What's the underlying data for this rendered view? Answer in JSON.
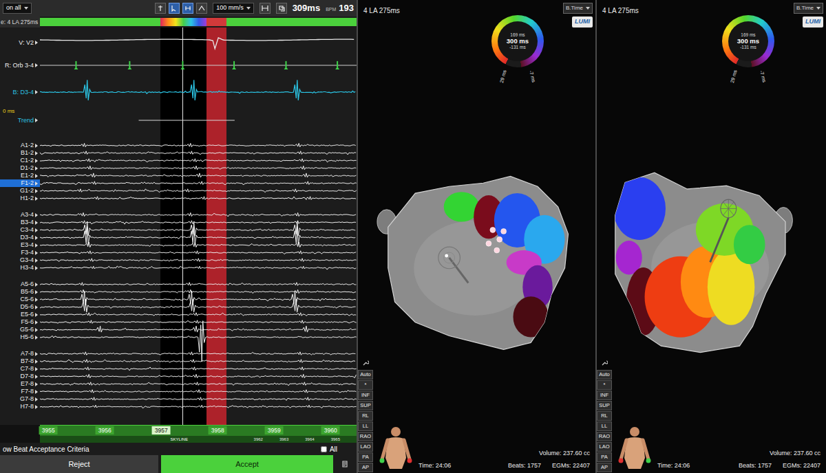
{
  "trace_view": {
    "title": "e: 4 LA 275ms",
    "toolbar": {
      "filter": "on all",
      "speed": "100 mm/s",
      "cycle": "309ms",
      "bpm_label": "BPM",
      "bpm": "193"
    },
    "window": {
      "start": 3956.98,
      "end": 3957.8
    },
    "reference": {
      "start": 3957.8,
      "end": 3958.15
    },
    "marker": 3957.38,
    "axis": {
      "start": 3954.85,
      "end": 3960.46,
      "ticks": [
        {
          "label": "3955",
          "value": 3955,
          "selected": false
        },
        {
          "label": "3956",
          "value": 3956,
          "selected": false
        },
        {
          "label": "3957",
          "value": 3957,
          "selected": true
        },
        {
          "label": "3958",
          "value": 3958,
          "selected": false
        },
        {
          "label": "3959",
          "value": 3959,
          "selected": false
        },
        {
          "label": "3960",
          "value": 3960,
          "selected": false
        }
      ],
      "strip": [
        "3962",
        "3963",
        "3964",
        "3965"
      ],
      "badge": "SKYLINE"
    },
    "surface_channels": [
      {
        "label": "V: V2",
        "kind": "ecg",
        "color": "#e8e8e8",
        "spikes": [
          3957.95
        ],
        "amp": -0.8
      },
      {
        "label": "R: Orb 3-4",
        "kind": "ref",
        "color": "#3fd14a",
        "spikes": [
          3955.49,
          3956.44,
          3957.38,
          3958.29,
          3959.21,
          3960.12
        ],
        "amp": 0.6
      },
      {
        "label": "B: D3-4",
        "kind": "bipolar",
        "color": "#2bc4e4",
        "spikes": [
          3955.67,
          3957.56,
          3959.39
        ],
        "amp": 0.9
      }
    ],
    "zero_label": "0 ms",
    "trend": {
      "label": "Trend",
      "start": 3956.6,
      "end": 3958.3
    },
    "electrode_groups": [
      {
        "channels": [
          {
            "label": "A1-2",
            "selected": false,
            "spikes": [
              3955.62,
              3957.5,
              3959.42
            ],
            "amp": 0.35
          },
          {
            "label": "B1-2",
            "selected": false,
            "spikes": [
              3955.65,
              3957.52,
              3959.45
            ],
            "amp": 0.3
          },
          {
            "label": "C1-2",
            "selected": false,
            "spikes": [
              3955.7,
              3957.58,
              3959.48
            ],
            "amp": 0.3
          },
          {
            "label": "D1-2",
            "selected": false,
            "spikes": [
              3955.72,
              3957.6,
              3959.5
            ],
            "amp": 0.35
          },
          {
            "label": "E1-2",
            "selected": false,
            "spikes": [
              3955.78,
              3957.66,
              3959.55
            ],
            "amp": 0.4
          },
          {
            "label": "F1-2",
            "selected": true,
            "spikes": [
              3955.8,
              3957.7,
              3959.58
            ],
            "amp": 0.3
          },
          {
            "label": "G1-2",
            "selected": false,
            "spikes": [
              3955.55,
              3957.45,
              3959.36
            ],
            "amp": 0.3
          },
          {
            "label": "H1-2",
            "selected": false,
            "spikes": [
              3955.85,
              3957.74,
              3959.62
            ],
            "amp": 0.3
          }
        ]
      },
      {
        "channels": [
          {
            "label": "A3-4",
            "selected": false,
            "spikes": [
              3955.6,
              3957.5,
              3959.4
            ],
            "amp": 0.35
          },
          {
            "label": "B3-4",
            "selected": false,
            "spikes": [
              3955.62,
              3957.52,
              3959.4
            ],
            "amp": 0.3
          },
          {
            "label": "C3-4",
            "selected": false,
            "spikes": [
              3955.67,
              3957.56,
              3959.39
            ],
            "amp": 1.4
          },
          {
            "label": "D3-4",
            "selected": false,
            "spikes": [
              3955.67,
              3957.56,
              3959.39
            ],
            "amp": 1.8
          },
          {
            "label": "E3-4",
            "selected": false,
            "spikes": [
              3955.7,
              3957.58,
              3959.42
            ],
            "amp": 0.5
          },
          {
            "label": "F3-4",
            "selected": false,
            "spikes": [
              3955.72,
              3957.62,
              3959.45
            ],
            "amp": 0.3
          },
          {
            "label": "G3-4",
            "selected": false,
            "spikes": [
              3955.75,
              3957.64,
              3959.48
            ],
            "amp": 0.3
          },
          {
            "label": "H3-4",
            "selected": false,
            "spikes": [
              3955.78,
              3957.66,
              3959.5
            ],
            "amp": 0.25
          }
        ]
      },
      {
        "channels": [
          {
            "label": "A5-6",
            "selected": false,
            "spikes": [
              3955.58,
              3957.48,
              3959.38
            ],
            "amp": 0.3
          },
          {
            "label": "B5-6",
            "selected": false,
            "spikes": [
              3955.6,
              3957.5,
              3959.4
            ],
            "amp": 0.35
          },
          {
            "label": "C5-6",
            "selected": false,
            "spikes": [
              3955.62,
              3957.52,
              3959.35
            ],
            "amp": 1.4
          },
          {
            "label": "D5-6",
            "selected": false,
            "spikes": [
              3955.64,
              3957.54,
              3959.37
            ],
            "amp": 1.3
          },
          {
            "label": "E5-6",
            "selected": false,
            "spikes": [
              3955.7,
              3957.6,
              3959.45
            ],
            "amp": 0.3
          },
          {
            "label": "F5-6",
            "selected": false,
            "spikes": [
              3955.74,
              3957.62,
              3959.48
            ],
            "amp": 0.3
          },
          {
            "label": "G5-6",
            "selected": false,
            "spikes": [
              3955.9,
              3957.6,
              3959.55
            ],
            "amp": 0.6
          },
          {
            "label": "H5-6",
            "selected": false,
            "spikes": [
              3957.7
            ],
            "amp": -4
          }
        ]
      },
      {
        "channels": [
          {
            "label": "A7-8",
            "selected": false,
            "spikes": [
              3955.64,
              3957.52,
              3959.44
            ],
            "amp": 0.3
          },
          {
            "label": "B7-8",
            "selected": false,
            "spikes": [
              3955.66,
              3957.55,
              3959.46
            ],
            "amp": 0.3
          },
          {
            "label": "C7-8",
            "selected": false,
            "spikes": [
              3955.68,
              3957.57,
              3959.48
            ],
            "amp": 0.3
          },
          {
            "label": "D7-8",
            "selected": false,
            "spikes": [
              3955.7,
              3957.6,
              3959.5
            ],
            "amp": 0.35
          },
          {
            "label": "E7-8",
            "selected": false,
            "spikes": [
              3955.73,
              3957.62,
              3959.52
            ],
            "amp": 0.3
          },
          {
            "label": "F7-8",
            "selected": false,
            "spikes": [
              3955.76,
              3957.65,
              3959.55
            ],
            "amp": 0.3
          },
          {
            "label": "G7-8",
            "selected": false,
            "spikes": [
              3955.79,
              3957.68,
              3959.58
            ],
            "amp": 0.3
          },
          {
            "label": "H7-8",
            "selected": false,
            "spikes": [
              3955.82,
              3957.7,
              3959.6
            ],
            "amp": 0.25
          }
        ]
      }
    ]
  },
  "acceptance": {
    "label": "ow Beat Acceptance Criteria",
    "all": {
      "label": "All",
      "checked": false
    },
    "buttons": [
      "Reject",
      "Accept"
    ]
  },
  "maps": [
    {
      "title": "4 LA 275ms",
      "mode": "B.Time",
      "badge": "LUMI",
      "kind": "lumipoint",
      "wheel": {
        "upper": "169 ms",
        "range": "300 ms",
        "lower": "-131 ms",
        "left": "29 ms",
        "right": "-7 ms"
      },
      "controls": [
        "Auto",
        "*",
        "INF",
        "SUP",
        "RL",
        "LL",
        "RAO",
        "LAO",
        "PA",
        "AP"
      ],
      "stats": {
        "time": "Time: 24:06",
        "beats": "Beats: 1757",
        "volume": "Volume: 237.60 cc",
        "egms": "EGMs: 22407"
      }
    },
    {
      "title": "4 LA 275ms",
      "mode": "B.Time",
      "badge": "LUMI",
      "kind": "activation",
      "wheel": {
        "upper": "169 ms",
        "range": "300 ms",
        "lower": "-131 ms",
        "left": "29 ms",
        "right": "-7 ms"
      },
      "controls": [
        "Auto",
        "*",
        "INF",
        "SUP",
        "RL",
        "LL",
        "RAO",
        "LAO",
        "PA",
        "AP"
      ],
      "stats": {
        "time": "Time: 24:06",
        "beats": "Beats: 1757",
        "volume": "Volume: 237.60 cc",
        "egms": "EGMs: 22407"
      }
    }
  ]
}
